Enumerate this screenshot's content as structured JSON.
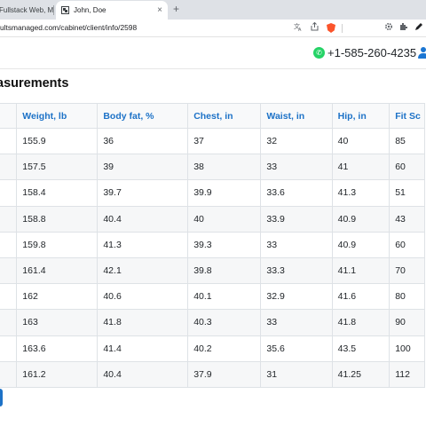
{
  "browser": {
    "tabs": [
      {
        "title": "Fullstack Web, Mo",
        "active": false
      },
      {
        "title": "John, Doe",
        "active": true
      }
    ],
    "new_tab_symbol": "+",
    "close_symbol": "×",
    "url": "ultsmanaged.com/cabinet/client/info/2598",
    "toolbar_icons": [
      "translate-icon",
      "share-icon",
      "bookmark-icon",
      "brave-shield-icon",
      "settings-icon",
      "extensions-icon",
      "pen-icon"
    ]
  },
  "header": {
    "phone": "+1-585-260-4235",
    "whatsapp_color": "#25d366",
    "accent_color": "#1d72c7"
  },
  "section": {
    "title": "asurements"
  },
  "table": {
    "columns": [
      "",
      "Weight, lb",
      "Body fat, %",
      "Chest, in",
      "Waist, in",
      "Hip, in",
      "Fit Sc"
    ],
    "rows": [
      [
        "",
        "155.9",
        "36",
        "37",
        "32",
        "40",
        "85"
      ],
      [
        "",
        "157.5",
        "39",
        "38",
        "33",
        "41",
        "60"
      ],
      [
        "",
        "158.4",
        "39.7",
        "39.9",
        "33.6",
        "41.3",
        "51"
      ],
      [
        "",
        "158.8",
        "40.4",
        "40",
        "33.9",
        "40.9",
        "43"
      ],
      [
        "",
        "159.8",
        "41.3",
        "39.3",
        "33",
        "40.9",
        "60"
      ],
      [
        "",
        "161.4",
        "42.1",
        "39.8",
        "33.3",
        "41.1",
        "70"
      ],
      [
        "",
        "162",
        "40.6",
        "40.1",
        "32.9",
        "41.6",
        "80"
      ],
      [
        "",
        "163",
        "41.8",
        "40.3",
        "33",
        "41.8",
        "90"
      ],
      [
        "",
        "163.6",
        "41.4",
        "40.2",
        "35.6",
        "43.5",
        "100"
      ],
      [
        "",
        "161.2",
        "40.4",
        "37.9",
        "31",
        "41.25",
        "112"
      ]
    ]
  }
}
